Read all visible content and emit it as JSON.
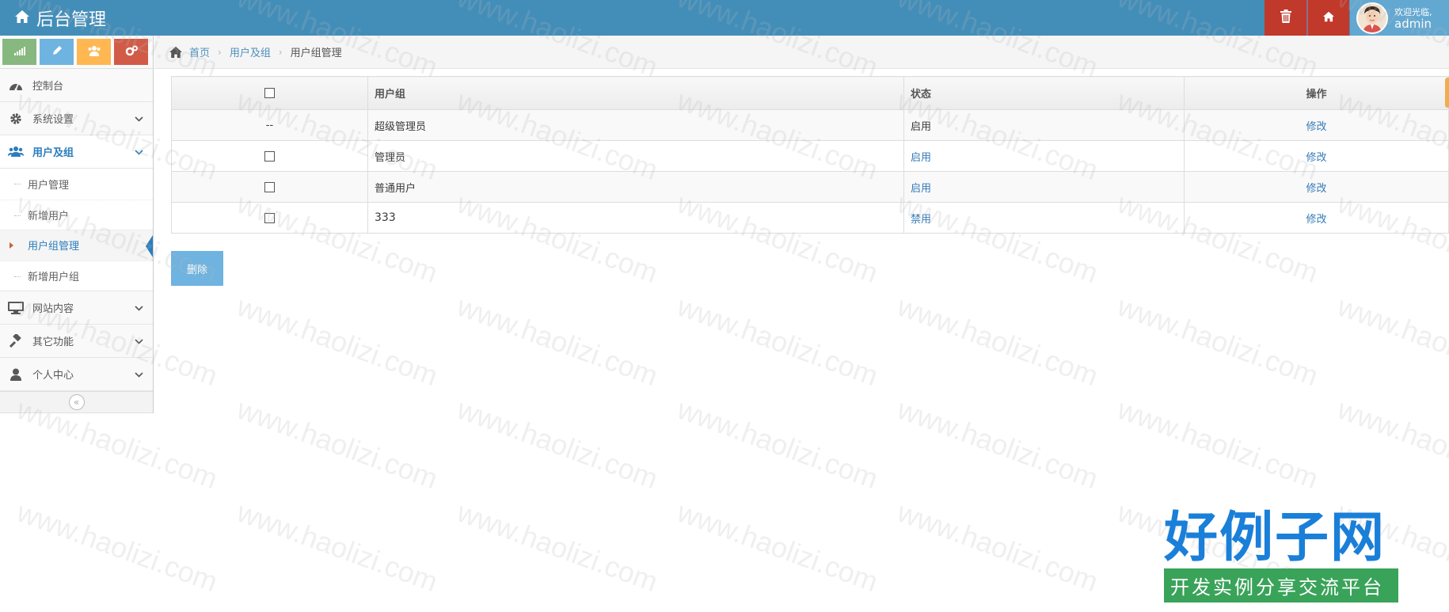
{
  "navbar": {
    "brand": "后台管理",
    "welcome": "欢迎光临,",
    "username": "admin",
    "trash_icon": "trash-icon",
    "home_icon": "home-icon"
  },
  "shortcuts": [
    {
      "icon": "signal-icon",
      "color": "#87b87f"
    },
    {
      "icon": "pencil-icon",
      "color": "#6fb3e0"
    },
    {
      "icon": "group-icon",
      "color": "#ffb752"
    },
    {
      "icon": "cogs-icon",
      "color": "#d15b47"
    }
  ],
  "sidebar": {
    "dashboard": "控制台",
    "settings": "系统设置",
    "users_group": "用户及组",
    "sub": [
      "用户管理",
      "新增用户",
      "用户组管理",
      "新增用户组"
    ],
    "content": "网站内容",
    "other": "其它功能",
    "profile": "个人中心"
  },
  "breadcrumb": {
    "home": "首页",
    "parent": "用户及组",
    "current": "用户组管理"
  },
  "table": {
    "headers": [
      "用户组",
      "状态",
      "操作"
    ],
    "rows": [
      {
        "check": "--",
        "group": "超级管理员",
        "status": "启用",
        "action": "修改"
      },
      {
        "check": "",
        "group": "管理员",
        "status": "启用",
        "action": "修改"
      },
      {
        "check": "",
        "group": "普通用户",
        "status": "启用",
        "action": "修改"
      },
      {
        "check": "",
        "group": "333",
        "status": "禁用",
        "action": "修改"
      }
    ]
  },
  "delete_button": "删除",
  "watermark": {
    "text": "www.haolizi.com",
    "logo_title": "好例子网",
    "logo_sub": "开发实例分享交流平台"
  }
}
